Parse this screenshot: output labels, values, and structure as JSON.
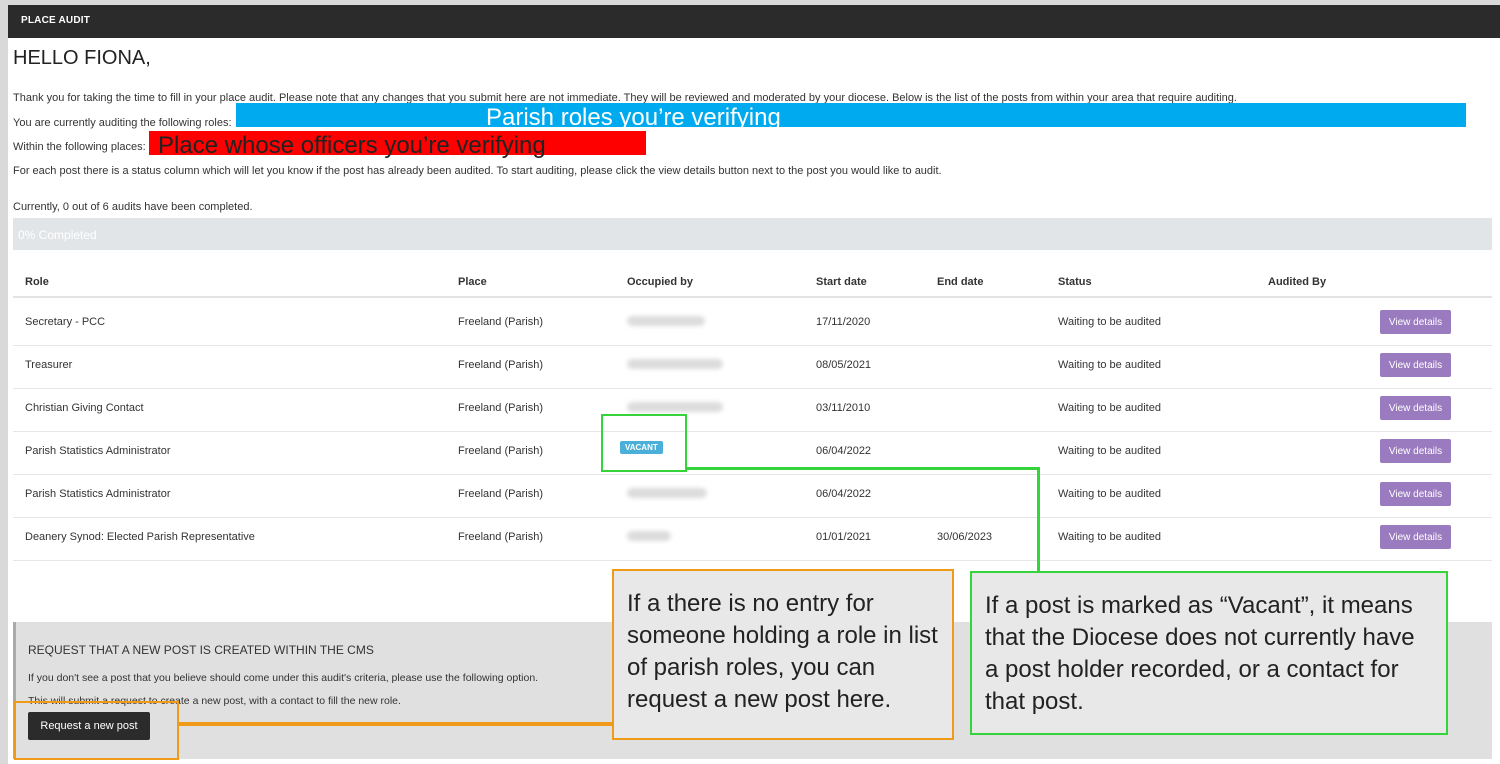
{
  "header": {
    "title": "PLACE AUDIT"
  },
  "greeting": "HELLO FIONA,",
  "intro": {
    "line1": "Thank you for taking the time to fill in your place audit. Please note that any changes that you submit here are not immediate. They will be reviewed and moderated by your diocese. Below is the list of the posts from within your area that require auditing.",
    "roles_label": "You are currently auditing the following roles:",
    "places_label": "Within the following places:",
    "line4": "For each post there is a status column which will let you know if the post has already been audited. To start auditing, please click the view details button next to the post you would like to audit.",
    "summary": "Currently, 0 out of 6 audits have been completed."
  },
  "highlights": {
    "roles": "Parish roles you’re verifying",
    "places": "Place whose officers you’re verifying"
  },
  "progress": {
    "label": "0% Completed",
    "fraction": 0
  },
  "table": {
    "columns": [
      "Role",
      "Place",
      "Occupied by",
      "Start date",
      "End date",
      "Status",
      "Audited By"
    ],
    "rows": [
      {
        "role": "Secretary - PCC",
        "place": "Freeland (Parish)",
        "occupied": "",
        "start": "17/11/2020",
        "end": "",
        "status": "Waiting to be audited",
        "action": "View details"
      },
      {
        "role": "Treasurer",
        "place": "Freeland (Parish)",
        "occupied": "",
        "start": "08/05/2021",
        "end": "",
        "status": "Waiting to be audited",
        "action": "View details"
      },
      {
        "role": "Christian Giving Contact",
        "place": "Freeland (Parish)",
        "occupied": "",
        "start": "03/11/2010",
        "end": "",
        "status": "Waiting to be audited",
        "action": "View details"
      },
      {
        "role": "Parish Statistics Administrator",
        "place": "Freeland (Parish)",
        "occupied": "VACANT",
        "start": "06/04/2022",
        "end": "",
        "status": "Waiting to be audited",
        "action": "View details"
      },
      {
        "role": "Parish Statistics Administrator",
        "place": "Freeland (Parish)",
        "occupied": "",
        "start": "06/04/2022",
        "end": "",
        "status": "Waiting to be audited",
        "action": "View details"
      },
      {
        "role": "Deanery Synod: Elected Parish Representative",
        "place": "Freeland (Parish)",
        "occupied": "",
        "start": "01/01/2021",
        "end": "30/06/2023",
        "status": "Waiting to be audited",
        "action": "View details"
      }
    ]
  },
  "request": {
    "title": "REQUEST THAT A NEW POST IS CREATED WITHIN THE CMS",
    "line1": "If you don't see a post that you believe should come under this audit's criteria, please use the following option.",
    "line2": "This will submit a request to create a new post, with a contact to fill the new role.",
    "button": "Request a new post"
  },
  "callouts": {
    "request_note": "If a there is no entry for someone holding a role in list of parish roles, you can request a new post here.",
    "vacant_note": "If a post is marked as “Vacant”, it means that the Diocese does not currently have a post holder recorded, or a contact for that post."
  },
  "colors": {
    "topbar": "#2b2b2b",
    "view_button": "#9b7bbf",
    "vacant_badge": "#4ab0d9",
    "annotation_green": "#35d43a",
    "annotation_orange": "#f09a1a",
    "highlight_blue": "#00aaee",
    "highlight_red": "#ff0000"
  }
}
